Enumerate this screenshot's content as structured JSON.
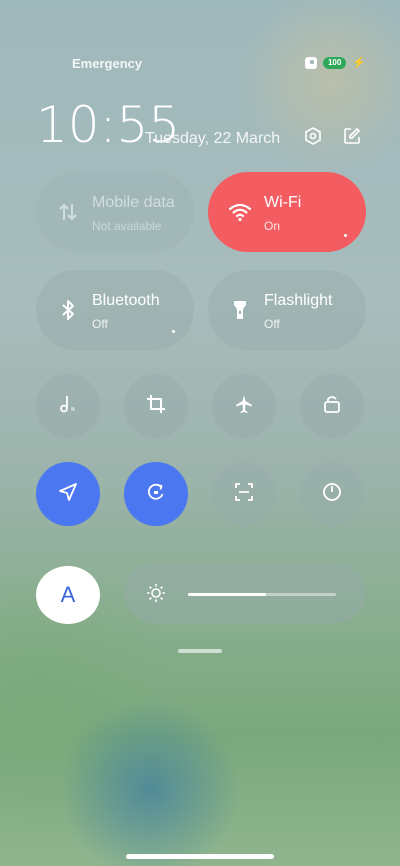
{
  "status_bar": {
    "carrier": "Emergency",
    "battery": "100"
  },
  "header": {
    "time": "10:55",
    "date": "Tuesday, 22 March"
  },
  "big_tiles": [
    {
      "title": "Mobile data",
      "subtitle": "Not available",
      "icon": "mobile-data-icon",
      "state": "disabled"
    },
    {
      "title": "Wi-Fi",
      "subtitle": "On",
      "icon": "wifi-icon",
      "state": "on",
      "color": "#f35c60"
    },
    {
      "title": "Bluetooth",
      "subtitle": "Off",
      "icon": "bluetooth-icon",
      "state": "off"
    },
    {
      "title": "Flashlight",
      "subtitle": "Off",
      "icon": "flashlight-icon",
      "state": "off"
    }
  ],
  "small_tiles": [
    {
      "icon": "music-note-icon",
      "active": false
    },
    {
      "icon": "crop-icon",
      "active": false
    },
    {
      "icon": "airplane-icon",
      "active": false
    },
    {
      "icon": "lock-icon",
      "active": false
    },
    {
      "icon": "location-icon",
      "active": true
    },
    {
      "icon": "rotation-lock-icon",
      "active": true
    },
    {
      "icon": "scanner-icon",
      "active": false
    },
    {
      "icon": "dark-mode-icon",
      "active": false
    }
  ],
  "brightness": {
    "auto_label": "A",
    "level": 0.53
  },
  "colors": {
    "accent": "#4b77f0",
    "wifi": "#f35c60",
    "battery": "#2fa85a"
  }
}
